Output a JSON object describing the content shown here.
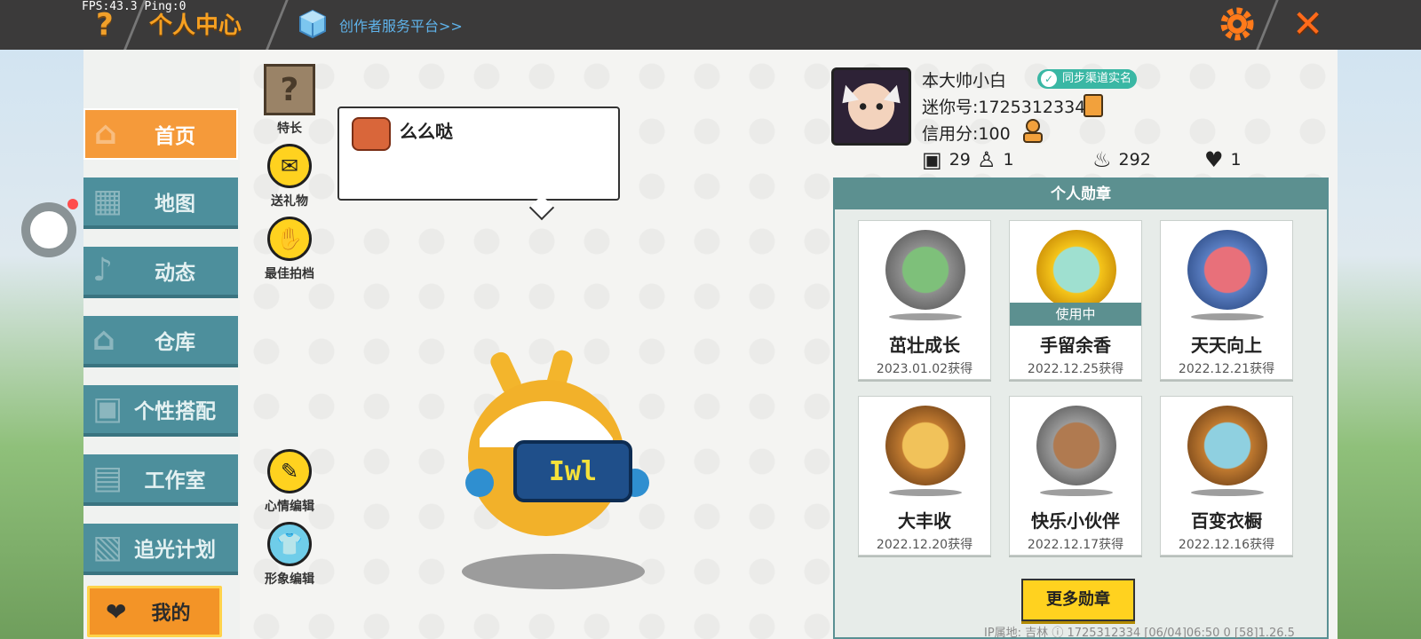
{
  "overlay": {
    "fps": "FPS:43.3  Ping:0"
  },
  "header": {
    "title": "个人中心",
    "creator_link": "创作者服务平台>>"
  },
  "sidebar": {
    "items": [
      {
        "label": "首页",
        "active": true
      },
      {
        "label": "地图",
        "active": false
      },
      {
        "label": "动态",
        "active": false
      },
      {
        "label": "仓库",
        "active": false
      },
      {
        "label": "个性搭配",
        "active": false
      },
      {
        "label": "工作室",
        "active": false
      },
      {
        "label": "追光计划",
        "active": false
      }
    ],
    "mine_label": "我的"
  },
  "actions": {
    "specialty": "特长",
    "send_gift": "送礼物",
    "best_partner": "最佳拍档",
    "mood_edit": "心情编辑",
    "avatar_edit": "形象编辑"
  },
  "bubble": {
    "text": "么么哒"
  },
  "profile": {
    "username": "本大帅小白",
    "sync_badge": "同步渠道实名",
    "mini_id": "迷你号:1725312334",
    "credit": "信用分:100",
    "stats": {
      "posts": "29",
      "fans": "1",
      "popularity": "292",
      "likes": "1"
    }
  },
  "medals": {
    "header": "个人勋章",
    "in_use_label": "使用中",
    "items": [
      {
        "name": "茁壮成长",
        "date": "2023.01.02获得"
      },
      {
        "name": "手留余香",
        "date": "2022.12.25获得"
      },
      {
        "name": "天天向上",
        "date": "2022.12.21获得"
      },
      {
        "name": "大丰收",
        "date": "2022.12.20获得"
      },
      {
        "name": "快乐小伙伴",
        "date": "2022.12.17获得"
      },
      {
        "name": "百变衣橱",
        "date": "2022.12.16获得"
      }
    ],
    "more_button": "更多勋章"
  },
  "footer": {
    "text": "IP属地: 吉林 ⓘ    1725312334    [06/04]06:50 0  [58]1.26.5"
  },
  "colors": {
    "accent_orange": "#f59a3a",
    "teal": "#4d8f9c",
    "yellow": "#ffd21f",
    "topbar": "#3b3a3a"
  }
}
